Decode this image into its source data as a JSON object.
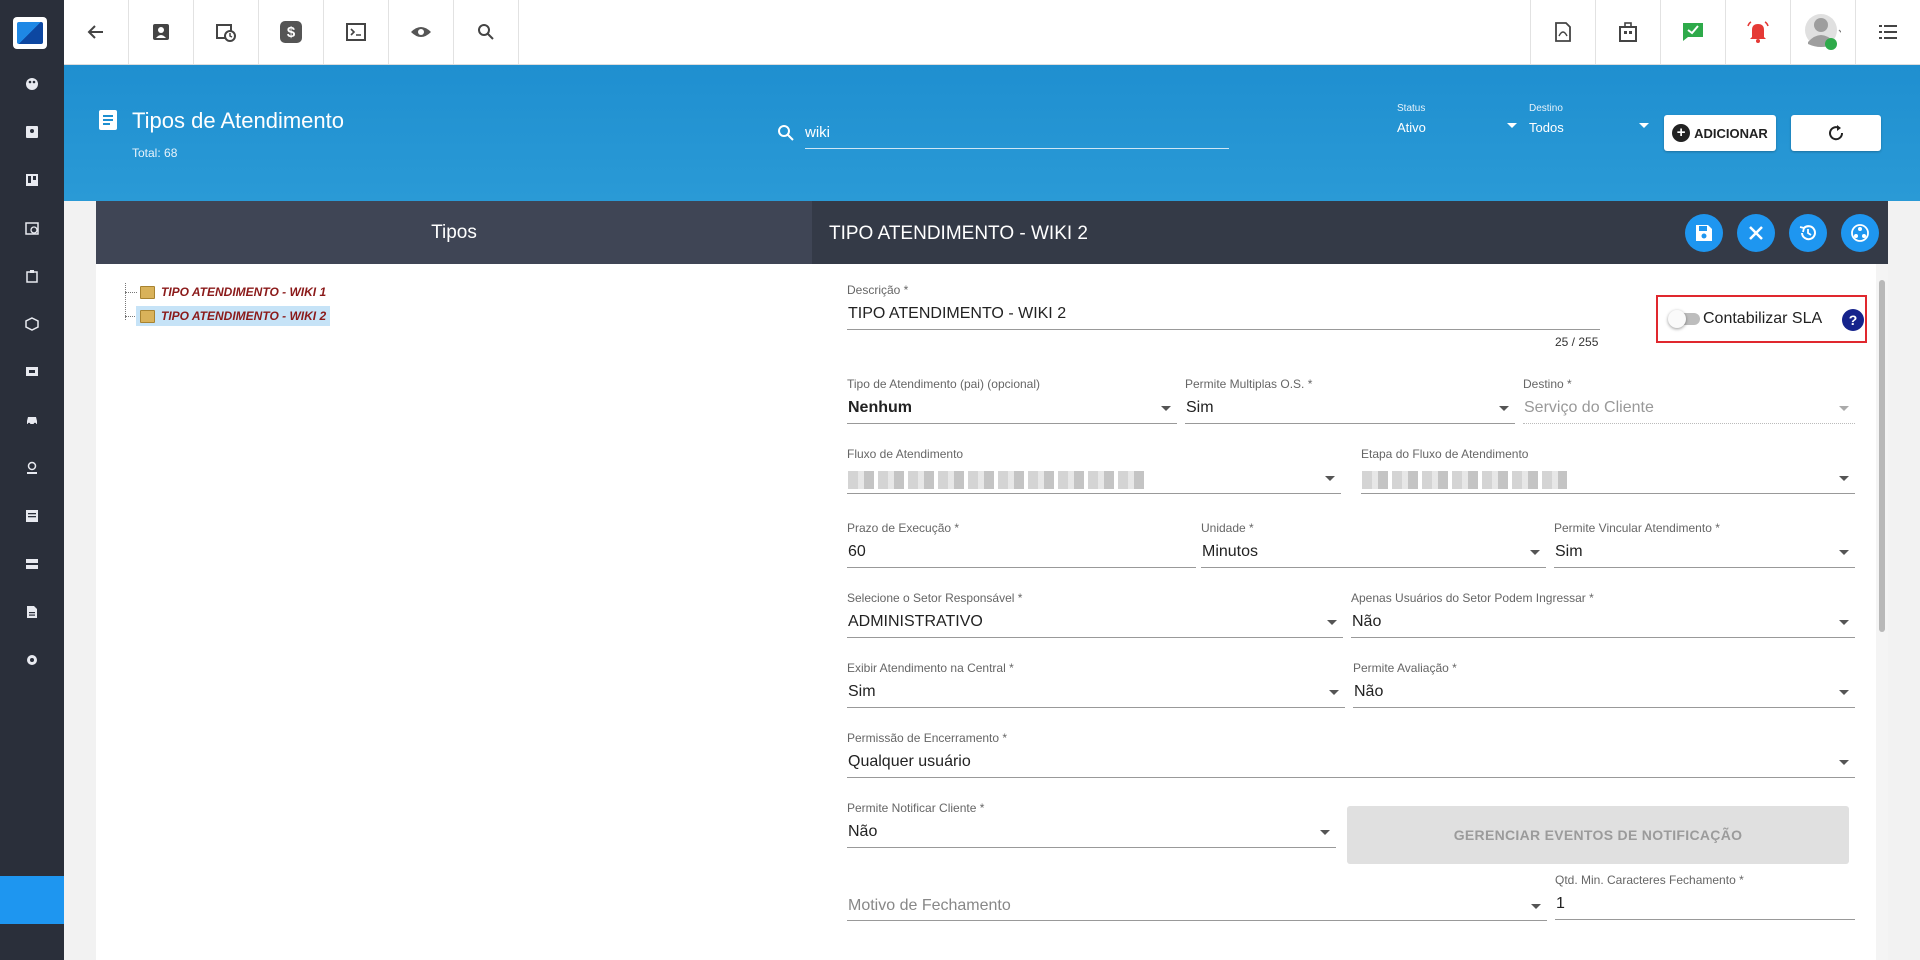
{
  "sidebar": {
    "icons": [
      "palette-icon",
      "contact-icon",
      "board-icon",
      "schedule-icon",
      "building-icon",
      "cube-icon",
      "monitor-icon",
      "car-icon",
      "location-icon",
      "list-icon",
      "server-icon",
      "document-icon",
      "gear-icon"
    ]
  },
  "topbar": {
    "left_icons": [
      "back-icon",
      "contact-card-icon",
      "calendar-clock-icon",
      "dollar-icon",
      "terminal-icon",
      "eye-icon",
      "search-icon"
    ],
    "right_icons": [
      "pdf-icon",
      "building-icon",
      "chat-check-icon",
      "alarm-bell-icon",
      "user-avatar",
      "menu-icon"
    ]
  },
  "header": {
    "title": "Tipos de Atendimento",
    "total": "Total: 68",
    "search_value": "wiki",
    "status_label": "Status",
    "status_value": "Ativo",
    "destino_label": "Destino",
    "destino_value": "Todos",
    "add_label": "ADICIONAR"
  },
  "tabs": {
    "left": "Tipos",
    "form_title": "TIPO ATENDIMENTO - WIKI 2"
  },
  "tree": {
    "items": [
      "TIPO ATENDIMENTO - WIKI 1",
      "TIPO ATENDIMENTO - WIKI 2"
    ]
  },
  "form": {
    "descricao_label": "Descrição *",
    "descricao_value": "TIPO ATENDIMENTO - WIKI 2",
    "descricao_counter": "25 / 255",
    "sla_label": "Contabilizar SLA",
    "sla_help": "?",
    "tipo_pai_label": "Tipo de Atendimento (pai) (opcional)",
    "tipo_pai_value": "Nenhum",
    "multiplas_label": "Permite Multiplas O.S. *",
    "multiplas_value": "Sim",
    "destino_label": "Destino *",
    "destino_value": "Serviço do Cliente",
    "fluxo_label": "Fluxo de Atendimento",
    "etapa_label": "Etapa do Fluxo de Atendimento",
    "prazo_label": "Prazo de Execução *",
    "prazo_value": "60",
    "unidade_label": "Unidade *",
    "unidade_value": "Minutos",
    "vincular_label": "Permite Vincular Atendimento *",
    "vincular_value": "Sim",
    "setor_label": "Selecione o Setor Responsável *",
    "setor_value": "ADMINISTRATIVO",
    "apenas_label": "Apenas Usuários do Setor Podem Ingressar *",
    "apenas_value": "Não",
    "exibir_label": "Exibir Atendimento na Central *",
    "exibir_value": "Sim",
    "avaliacao_label": "Permite Avaliação *",
    "avaliacao_value": "Não",
    "encerramento_label": "Permissão de Encerramento *",
    "encerramento_value": "Qualquer usuário",
    "notificar_label": "Permite Notificar Cliente *",
    "notificar_value": "Não",
    "notify_button": "GERENCIAR EVENTOS DE NOTIFICAÇÃO",
    "motivo_placeholder": "Motivo de Fechamento",
    "qtd_label": "Qtd. Min. Caracteres Fechamento *",
    "qtd_value": "1"
  },
  "colors": {
    "header_blue": "#2196d6",
    "sidebar": "#2a2f3a",
    "accent": "#1e96f0",
    "highlight_border": "#e0282e"
  }
}
